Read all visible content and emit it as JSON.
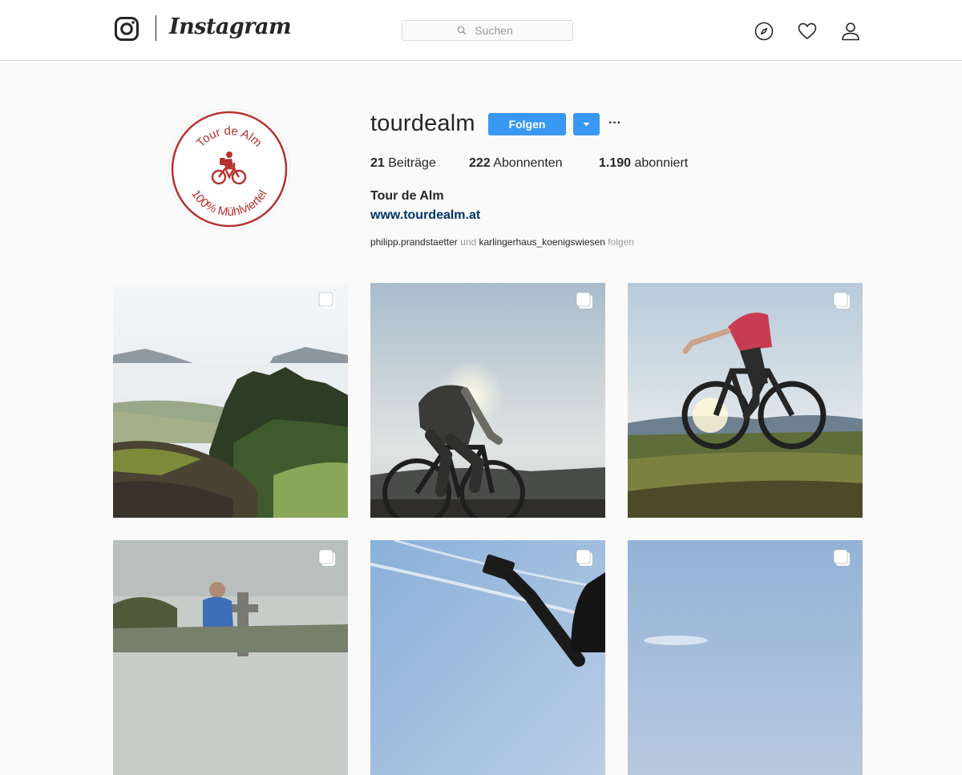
{
  "header": {
    "app_name": "Instagram",
    "search_placeholder": "Suchen",
    "nav_icons": [
      "explore-compass-icon",
      "activity-heart-icon",
      "profile-person-icon"
    ]
  },
  "profile": {
    "username": "tourdealm",
    "follow_label": "Folgen",
    "more_label": "···",
    "stats": [
      {
        "count": "21",
        "label": "Beiträge"
      },
      {
        "count": "222",
        "label": "Abonnenten"
      },
      {
        "count": "1.190",
        "label": "abonniert"
      }
    ],
    "full_name": "Tour de Alm",
    "website": "www.tourdealm.at",
    "followed_by": {
      "user1": "philipp.prandstaetter",
      "conj": "und",
      "user2": "karlingerhaus_koenigswiesen",
      "suffix": "folgen"
    },
    "avatar": {
      "text_top": "Tour de Alm",
      "text_bottom": "100% Mühlviertel",
      "color": "#b5322e"
    }
  },
  "colors": {
    "accent": "#3897f0",
    "link": "#003569",
    "border": "#dbdbdb",
    "background": "#fafafa"
  },
  "posts": [
    {
      "subject": "misty valley with forest and mossy rock",
      "multi": true
    },
    {
      "subject": "cyclist silhouette against sun",
      "multi": true
    },
    {
      "subject": "mountain biker on grass at sunset",
      "multi": true
    },
    {
      "subject": "cyclist sitting near summit cross",
      "multi": true
    },
    {
      "subject": "hand holding phone against sky",
      "multi": true
    },
    {
      "subject": "blue sky",
      "multi": true
    }
  ]
}
